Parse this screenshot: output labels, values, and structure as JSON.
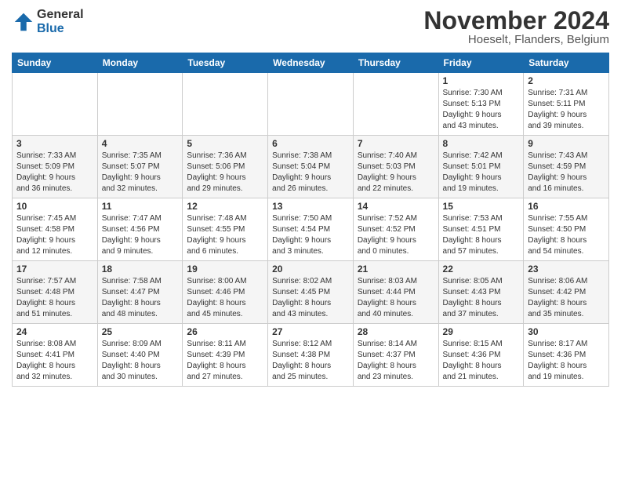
{
  "logo": {
    "general": "General",
    "blue": "Blue"
  },
  "title": "November 2024",
  "location": "Hoeselt, Flanders, Belgium",
  "headers": [
    "Sunday",
    "Monday",
    "Tuesday",
    "Wednesday",
    "Thursday",
    "Friday",
    "Saturday"
  ],
  "weeks": [
    [
      {
        "day": "",
        "info": ""
      },
      {
        "day": "",
        "info": ""
      },
      {
        "day": "",
        "info": ""
      },
      {
        "day": "",
        "info": ""
      },
      {
        "day": "",
        "info": ""
      },
      {
        "day": "1",
        "info": "Sunrise: 7:30 AM\nSunset: 5:13 PM\nDaylight: 9 hours\nand 43 minutes."
      },
      {
        "day": "2",
        "info": "Sunrise: 7:31 AM\nSunset: 5:11 PM\nDaylight: 9 hours\nand 39 minutes."
      }
    ],
    [
      {
        "day": "3",
        "info": "Sunrise: 7:33 AM\nSunset: 5:09 PM\nDaylight: 9 hours\nand 36 minutes."
      },
      {
        "day": "4",
        "info": "Sunrise: 7:35 AM\nSunset: 5:07 PM\nDaylight: 9 hours\nand 32 minutes."
      },
      {
        "day": "5",
        "info": "Sunrise: 7:36 AM\nSunset: 5:06 PM\nDaylight: 9 hours\nand 29 minutes."
      },
      {
        "day": "6",
        "info": "Sunrise: 7:38 AM\nSunset: 5:04 PM\nDaylight: 9 hours\nand 26 minutes."
      },
      {
        "day": "7",
        "info": "Sunrise: 7:40 AM\nSunset: 5:03 PM\nDaylight: 9 hours\nand 22 minutes."
      },
      {
        "day": "8",
        "info": "Sunrise: 7:42 AM\nSunset: 5:01 PM\nDaylight: 9 hours\nand 19 minutes."
      },
      {
        "day": "9",
        "info": "Sunrise: 7:43 AM\nSunset: 4:59 PM\nDaylight: 9 hours\nand 16 minutes."
      }
    ],
    [
      {
        "day": "10",
        "info": "Sunrise: 7:45 AM\nSunset: 4:58 PM\nDaylight: 9 hours\nand 12 minutes."
      },
      {
        "day": "11",
        "info": "Sunrise: 7:47 AM\nSunset: 4:56 PM\nDaylight: 9 hours\nand 9 minutes."
      },
      {
        "day": "12",
        "info": "Sunrise: 7:48 AM\nSunset: 4:55 PM\nDaylight: 9 hours\nand 6 minutes."
      },
      {
        "day": "13",
        "info": "Sunrise: 7:50 AM\nSunset: 4:54 PM\nDaylight: 9 hours\nand 3 minutes."
      },
      {
        "day": "14",
        "info": "Sunrise: 7:52 AM\nSunset: 4:52 PM\nDaylight: 9 hours\nand 0 minutes."
      },
      {
        "day": "15",
        "info": "Sunrise: 7:53 AM\nSunset: 4:51 PM\nDaylight: 8 hours\nand 57 minutes."
      },
      {
        "day": "16",
        "info": "Sunrise: 7:55 AM\nSunset: 4:50 PM\nDaylight: 8 hours\nand 54 minutes."
      }
    ],
    [
      {
        "day": "17",
        "info": "Sunrise: 7:57 AM\nSunset: 4:48 PM\nDaylight: 8 hours\nand 51 minutes."
      },
      {
        "day": "18",
        "info": "Sunrise: 7:58 AM\nSunset: 4:47 PM\nDaylight: 8 hours\nand 48 minutes."
      },
      {
        "day": "19",
        "info": "Sunrise: 8:00 AM\nSunset: 4:46 PM\nDaylight: 8 hours\nand 45 minutes."
      },
      {
        "day": "20",
        "info": "Sunrise: 8:02 AM\nSunset: 4:45 PM\nDaylight: 8 hours\nand 43 minutes."
      },
      {
        "day": "21",
        "info": "Sunrise: 8:03 AM\nSunset: 4:44 PM\nDaylight: 8 hours\nand 40 minutes."
      },
      {
        "day": "22",
        "info": "Sunrise: 8:05 AM\nSunset: 4:43 PM\nDaylight: 8 hours\nand 37 minutes."
      },
      {
        "day": "23",
        "info": "Sunrise: 8:06 AM\nSunset: 4:42 PM\nDaylight: 8 hours\nand 35 minutes."
      }
    ],
    [
      {
        "day": "24",
        "info": "Sunrise: 8:08 AM\nSunset: 4:41 PM\nDaylight: 8 hours\nand 32 minutes."
      },
      {
        "day": "25",
        "info": "Sunrise: 8:09 AM\nSunset: 4:40 PM\nDaylight: 8 hours\nand 30 minutes."
      },
      {
        "day": "26",
        "info": "Sunrise: 8:11 AM\nSunset: 4:39 PM\nDaylight: 8 hours\nand 27 minutes."
      },
      {
        "day": "27",
        "info": "Sunrise: 8:12 AM\nSunset: 4:38 PM\nDaylight: 8 hours\nand 25 minutes."
      },
      {
        "day": "28",
        "info": "Sunrise: 8:14 AM\nSunset: 4:37 PM\nDaylight: 8 hours\nand 23 minutes."
      },
      {
        "day": "29",
        "info": "Sunrise: 8:15 AM\nSunset: 4:36 PM\nDaylight: 8 hours\nand 21 minutes."
      },
      {
        "day": "30",
        "info": "Sunrise: 8:17 AM\nSunset: 4:36 PM\nDaylight: 8 hours\nand 19 minutes."
      }
    ]
  ]
}
